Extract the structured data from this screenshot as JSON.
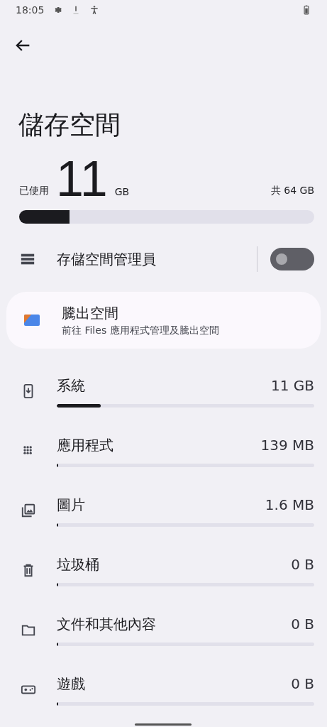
{
  "status_bar": {
    "time": "18:05"
  },
  "title": "儲存空間",
  "usage": {
    "label": "已使用",
    "amount": "11",
    "unit": "GB",
    "total": "共 64 GB",
    "level": 0.17
  },
  "storage_manager": {
    "label": "存儲空間管理員",
    "on": false
  },
  "free_up": {
    "title": "騰出空間",
    "subtitle": "前往 Files 應用程式管理及騰出空間"
  },
  "categories": [
    {
      "kind": "system",
      "name": "系統",
      "size": "11 GB",
      "level": 0.17
    },
    {
      "kind": "apps",
      "name": "應用程式",
      "size": "139 MB",
      "level": 0
    },
    {
      "kind": "images",
      "name": "圖片",
      "size": "1.6 MB",
      "level": 0
    },
    {
      "kind": "trash",
      "name": "垃圾桶",
      "size": "0 B",
      "level": 0
    },
    {
      "kind": "files",
      "name": "文件和其他內容",
      "size": "0 B",
      "level": 0
    },
    {
      "kind": "games",
      "name": "遊戲",
      "size": "0 B",
      "level": 0
    }
  ]
}
